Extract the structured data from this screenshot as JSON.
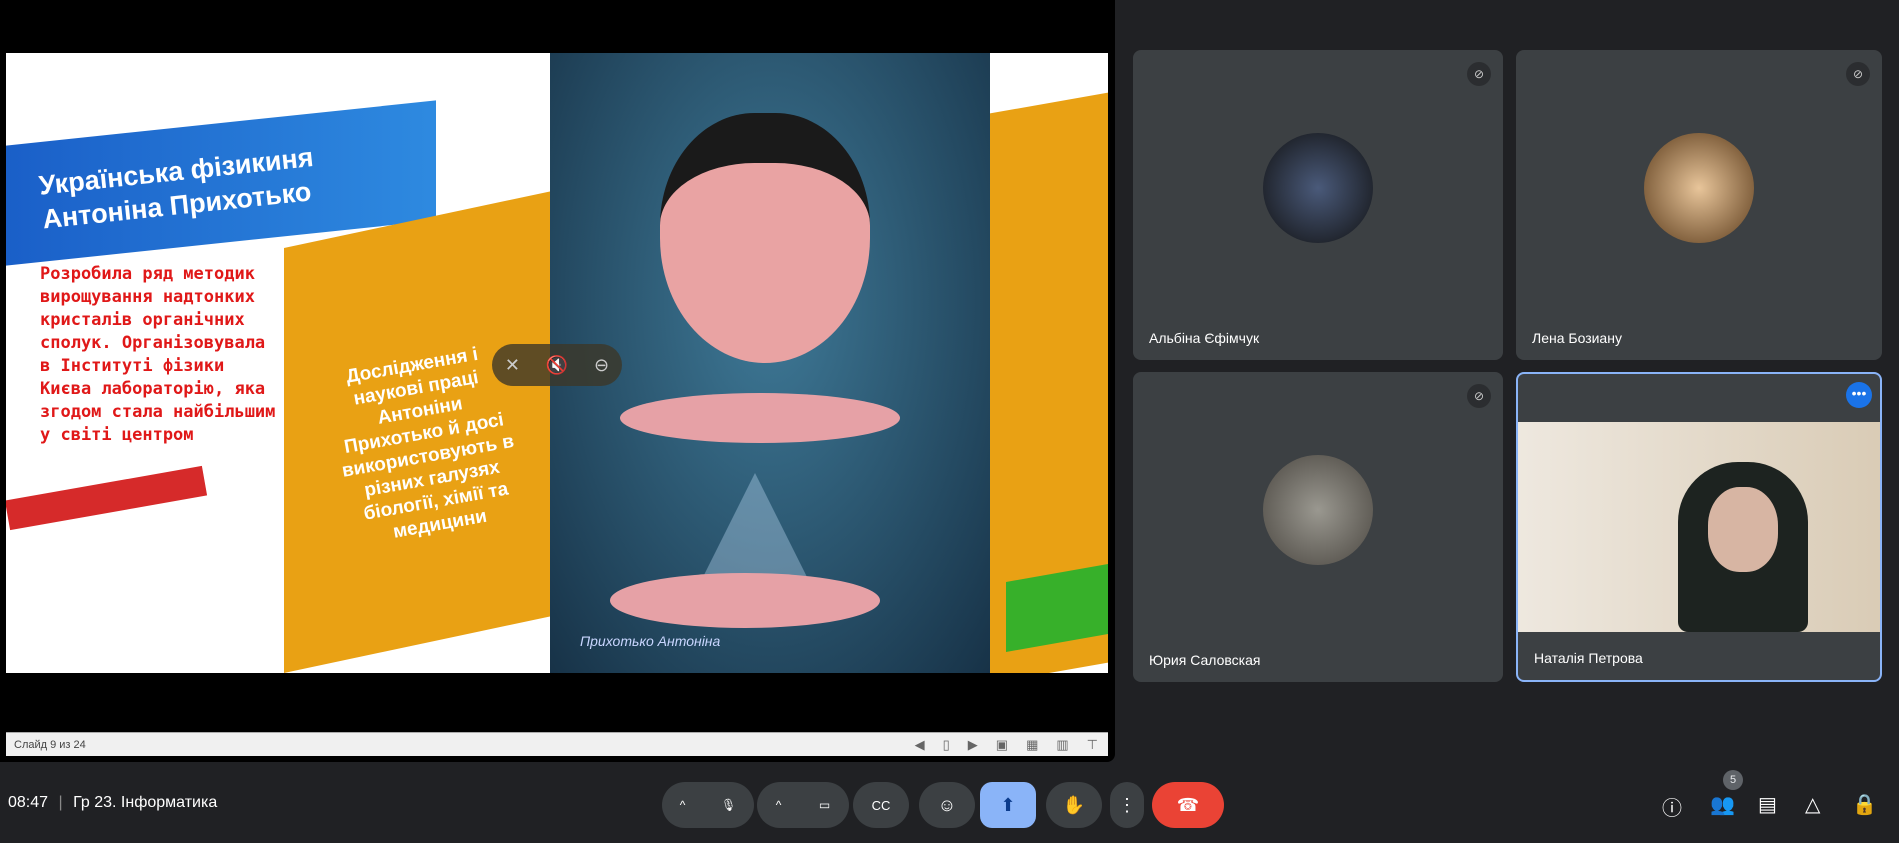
{
  "slide": {
    "title": "Українська фізикиня Антоніна Прихотько",
    "left_text": "Розробила ряд методик вирощування надтонких кристалів органічних сполук. Організовувала в Інституті фізики Києва лабораторію, яка згодом стала найбільшим у світі центром",
    "box_text": "Дослідження і наукові праці Антоніни Прихотько й досі використовують в різних галузях біології, хімії та медицини",
    "portrait_caption": "Прихотько Антоніна"
  },
  "status_bar": {
    "slide_counter": "Слайд 9 из 24"
  },
  "participants": [
    {
      "name": "Альбіна Єфімчук",
      "muted": true
    },
    {
      "name": "Лена Бозиану",
      "muted": true
    },
    {
      "name": "Юрия Саловская",
      "muted": true
    },
    {
      "name": "Наталія Петрова",
      "muted": false
    }
  ],
  "meeting": {
    "time": "08:47",
    "separator": "|",
    "title": "Гр 23. Інформатика",
    "participant_count": "5"
  },
  "colors": {
    "accent": "#8ab4f8",
    "end_call": "#ea4335",
    "bg": "#202124"
  }
}
